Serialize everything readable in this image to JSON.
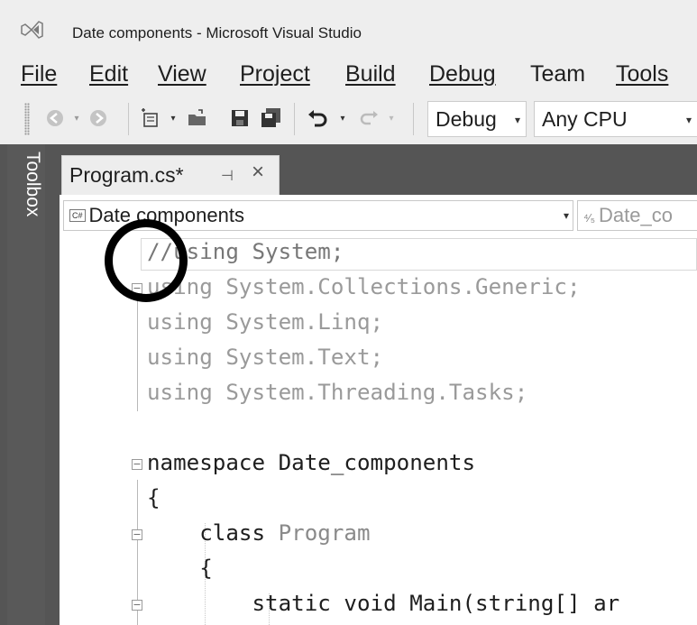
{
  "window": {
    "title": "Date components - Microsoft Visual Studio"
  },
  "menu": [
    {
      "label": "File"
    },
    {
      "label": "Edit"
    },
    {
      "label": "View"
    },
    {
      "label": "Project"
    },
    {
      "label": "Build"
    },
    {
      "label": "Debug"
    },
    {
      "label": "Team"
    },
    {
      "label": "Tools"
    }
  ],
  "toolbar": {
    "configuration": "Debug",
    "platform": "Any CPU"
  },
  "toolbox": {
    "label": "Toolbox"
  },
  "document_tab": {
    "label": "Program.cs*"
  },
  "navigation": {
    "project": "Date components",
    "class": "Date_co"
  },
  "code_lines": [
    "//using System;",
    "using System.Collections.Generic;",
    "using System.Linq;",
    "using System.Text;",
    "using System.Threading.Tasks;",
    "",
    "namespace Date_components",
    "{",
    "    class Program",
    "    {",
    "        static void Main(string[] ar"
  ],
  "code_colors": {
    "comment": "#777777",
    "dimmed_using": "#9a9a9a",
    "type_name": "#8a8a8a",
    "keyword": "#1e1e1e"
  },
  "annotation": {
    "shape": "hand-drawn circle",
    "color": "#000000"
  }
}
